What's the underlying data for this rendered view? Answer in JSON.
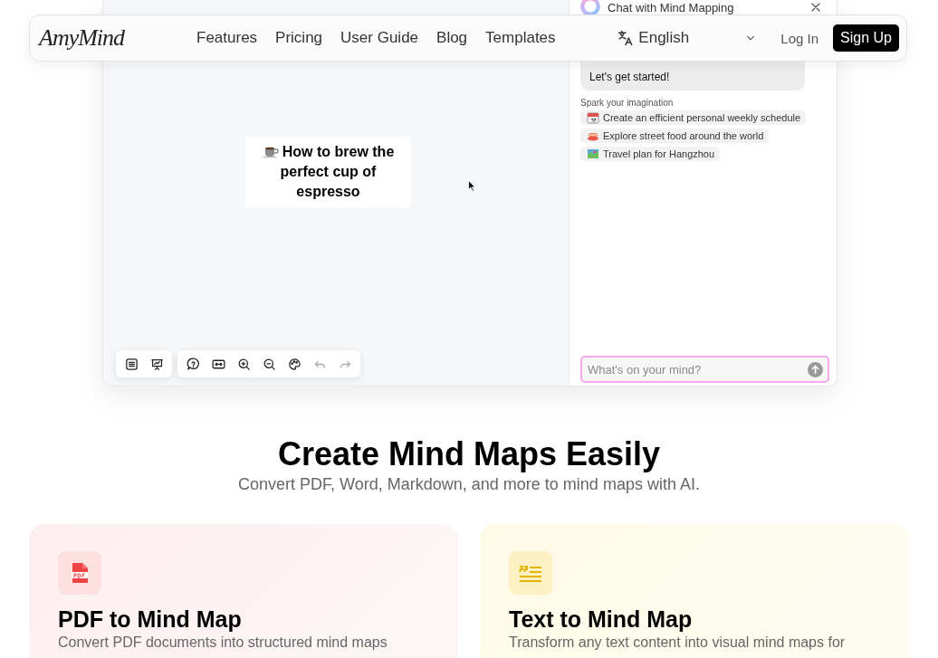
{
  "navbar": {
    "logo": "AmyMind",
    "links": [
      "Features",
      "Pricing",
      "User Guide",
      "Blog",
      "Templates"
    ],
    "language": "English",
    "login": "Log In",
    "signup": "Sign Up"
  },
  "demo": {
    "node": {
      "title": "How to brew the perfect cup of espresso"
    },
    "toolbar": [
      {
        "kind": "outline",
        "disabled": false
      },
      {
        "kind": "present",
        "disabled": false
      },
      {
        "kind": "help",
        "disabled": false
      },
      {
        "kind": "fit",
        "disabled": false
      },
      {
        "kind": "zoom-in",
        "disabled": false
      },
      {
        "kind": "zoom-out",
        "disabled": false
      },
      {
        "kind": "theme",
        "disabled": false
      },
      {
        "kind": "undo",
        "disabled": true
      },
      {
        "kind": "redo",
        "disabled": true
      }
    ],
    "chat": {
      "title": "Chat with Mind Mapping",
      "message": "Let's get started!",
      "suggestions_label": "Spark your imagination",
      "suggestions": [
        {
          "kind": "calendar",
          "text": "Create an efficient personal weekly schedule"
        },
        {
          "kind": "food",
          "text": "Explore street food around the world"
        },
        {
          "kind": "map",
          "text": "Travel plan for Hangzhou"
        }
      ],
      "input": {
        "placeholder": "What's on your mind?"
      }
    }
  },
  "hero": {
    "title": "Create Mind Maps Easily",
    "subtitle": "Convert PDF, Word, Markdown, and more to mind maps with AI."
  },
  "features": [
    {
      "kind": "pdf",
      "title": "PDF to Mind Map",
      "description": "Convert PDF documents into structured mind maps"
    },
    {
      "kind": "text",
      "title": "Text to Mind Map",
      "description": "Transform any text content into visual mind maps for"
    }
  ]
}
